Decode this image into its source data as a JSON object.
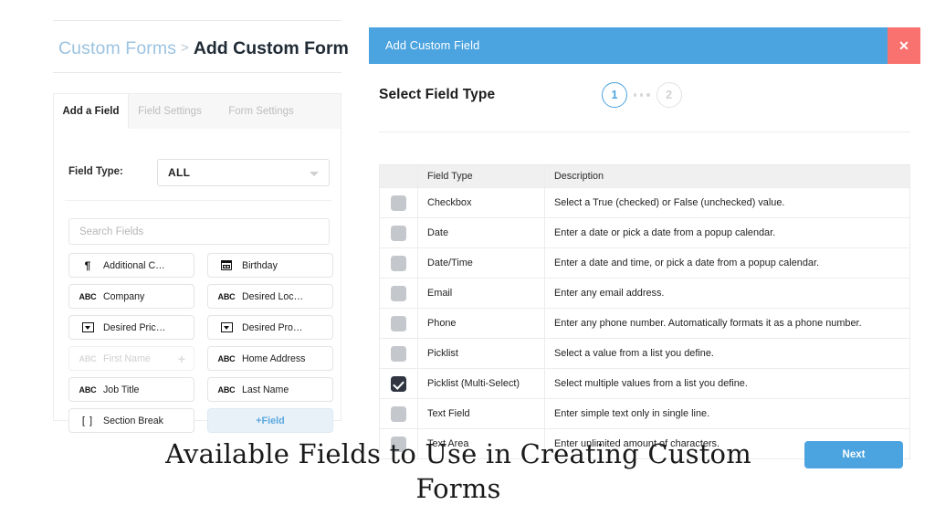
{
  "breadcrumb": {
    "parent": "Custom Forms",
    "separator": ">",
    "current": "Add Custom Form"
  },
  "tabs": [
    {
      "label": "Add a Field",
      "active": true
    },
    {
      "label": "Field Settings",
      "active": false
    },
    {
      "label": "Form Settings",
      "active": false
    }
  ],
  "left_panel": {
    "field_type_label": "Field Type:",
    "field_type_value": "ALL",
    "caret_icon": "chevron-down-icon",
    "search_placeholder": "Search Fields",
    "search_value": "",
    "fields": [
      {
        "label": "Additional C…",
        "icon": "pilcrow-icon",
        "disabled": false
      },
      {
        "label": "Birthday",
        "icon": "calendar-icon",
        "disabled": false
      },
      {
        "label": "Company",
        "icon": "abc-icon",
        "disabled": false
      },
      {
        "label": "Desired Loc…",
        "icon": "abc-icon",
        "disabled": false
      },
      {
        "label": "Desired Pric…",
        "icon": "dropdown-icon",
        "disabled": false
      },
      {
        "label": "Desired Pro…",
        "icon": "dropdown-icon",
        "disabled": false
      },
      {
        "label": "First Name",
        "icon": "abc-icon",
        "disabled": true,
        "plus": "+"
      },
      {
        "label": "Home Address",
        "icon": "abc-icon",
        "disabled": false
      },
      {
        "label": "Job Title",
        "icon": "abc-icon",
        "disabled": false
      },
      {
        "label": "Last Name",
        "icon": "abc-icon",
        "disabled": false
      },
      {
        "label": "Section Break",
        "icon": "bracket-icon",
        "disabled": false
      },
      {
        "label": "+Field",
        "icon": "add-icon",
        "disabled": false,
        "add_new": true
      }
    ]
  },
  "modal": {
    "title": "Add Custom Field",
    "close_label": "✕",
    "close_icon": "close-icon",
    "heading": "Select Field Type",
    "steps": [
      {
        "label": "1",
        "active": true
      },
      {
        "label": "2",
        "active": false
      }
    ],
    "table": {
      "headers": [
        "",
        "Field Type",
        "Description"
      ],
      "rows": [
        {
          "checked": false,
          "type": "Checkbox",
          "description": "Select a True (checked) or False (unchecked) value."
        },
        {
          "checked": false,
          "type": "Date",
          "description": "Enter a date or pick a date from a popup calendar."
        },
        {
          "checked": false,
          "type": "Date/Time",
          "description": "Enter a date and time, or pick a date from a popup calendar."
        },
        {
          "checked": false,
          "type": "Email",
          "description": "Enter any email address."
        },
        {
          "checked": false,
          "type": "Phone",
          "description": "Enter any phone number. Automatically formats it as a phone number."
        },
        {
          "checked": false,
          "type": "Picklist",
          "description": "Select a value from a list you define."
        },
        {
          "checked": true,
          "type": "Picklist (Multi-Select)",
          "description": "Select multiple values from a list you define."
        },
        {
          "checked": false,
          "type": "Text Field",
          "description": "Enter simple text only in single line."
        },
        {
          "checked": false,
          "type": "Text Area",
          "description": "Enter unlimited amount of characters."
        }
      ]
    }
  },
  "caption": "Available Fields to Use in Creating Custom Forms",
  "next_button": "Next",
  "colors": {
    "accent_blue": "#4BA3DF",
    "close_red": "#F9726F",
    "breadcrumb_parent": "#9CC3E0",
    "checkbox_grey": "#C4C7CC",
    "checkbox_checked": "#2F3640",
    "add_field_bg": "#E9F1F8"
  }
}
